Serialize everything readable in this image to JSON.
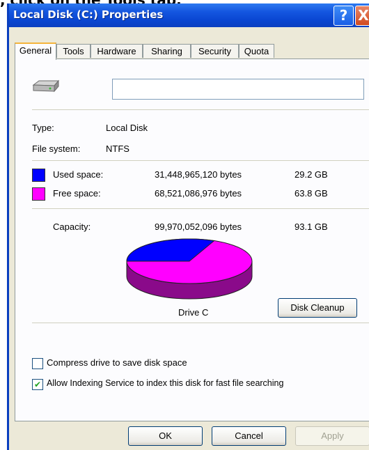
{
  "caption": ", click on the Tools tab.",
  "window": {
    "title": "Local Disk (C:) Properties",
    "help_glyph": "?",
    "close_glyph": "X"
  },
  "tabs": [
    {
      "label": "General",
      "active": true
    },
    {
      "label": "Tools"
    },
    {
      "label": "Hardware"
    },
    {
      "label": "Sharing"
    },
    {
      "label": "Security"
    },
    {
      "label": "Quota"
    }
  ],
  "general": {
    "drive_name_value": "",
    "type_label": "Type:",
    "type_value": "Local Disk",
    "fs_label": "File system:",
    "fs_value": "NTFS",
    "used": {
      "label": "Used space:",
      "bytes": "31,448,965,120 bytes",
      "size": "29.2 GB",
      "color": "#0000ff"
    },
    "free": {
      "label": "Free space:",
      "bytes": "68,521,086,976 bytes",
      "size": "63.8 GB",
      "color": "#ff00ff"
    },
    "capacity": {
      "label": "Capacity:",
      "bytes": "99,970,052,096 bytes",
      "size": "93.1 GB"
    },
    "drive_label": "Drive C",
    "disk_cleanup_label": "Disk Cleanup",
    "compress_label": "Compress drive to save disk space",
    "compress_checked": false,
    "index_label": "Allow Indexing Service to index this disk for fast file searching",
    "index_checked": true
  },
  "footer": {
    "ok_label": "OK",
    "cancel_label": "Cancel",
    "apply_label": "Apply"
  }
}
